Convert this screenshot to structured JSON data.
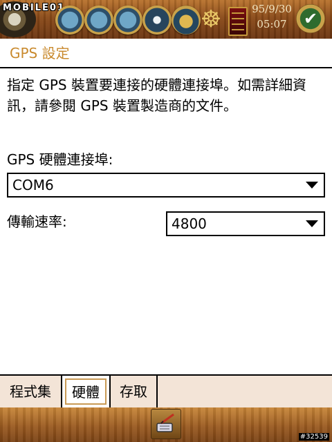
{
  "status_bar": {
    "logo_text": "MOBILE01",
    "date": "95/9/30",
    "time": "05:07",
    "icons": [
      "ship-porthole-icon",
      "sailboat-porthole-icon",
      "globe-porthole-icon",
      "signal-porthole-icon",
      "bell-porthole-icon",
      "ship-wheel-icon",
      "battery-icon",
      "ok-check-icon"
    ]
  },
  "page": {
    "title": "GPS 設定"
  },
  "content": {
    "description": "指定 GPS 裝置要連接的硬體連接埠。如需詳細資訊，請參閱 GPS 裝置製造商的文件。",
    "port_label": "GPS 硬體連接埠:",
    "port_value": "COM6",
    "baud_label": "傳輸速率:",
    "baud_value": "4800"
  },
  "tabs": [
    {
      "label": "程式集",
      "selected": false
    },
    {
      "label": "硬體",
      "selected": true
    },
    {
      "label": "存取",
      "selected": false
    }
  ],
  "bottom_bar": {
    "input_icon": "keyboard-pen-icon",
    "image_id": "#32539"
  },
  "colors": {
    "title": "#c98a2e",
    "tab_bg": "#f3e4d7",
    "wood": "#8a4a18"
  }
}
